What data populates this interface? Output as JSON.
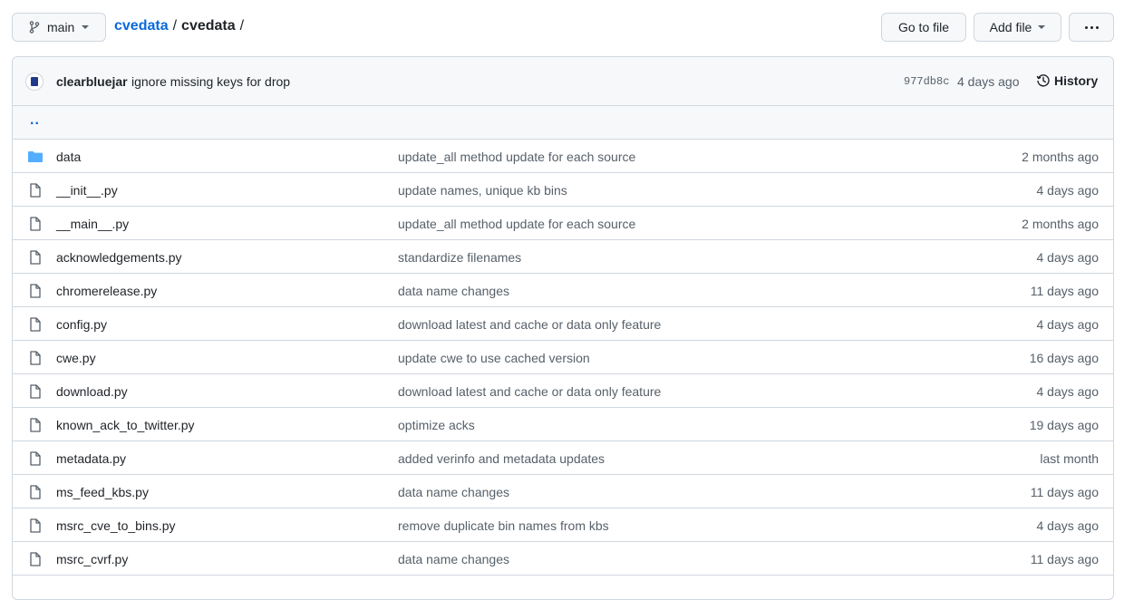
{
  "header": {
    "branch": "main",
    "repo": "cvedata",
    "path_sep": "/",
    "folder": "cvedata",
    "trailing_sep": "/",
    "goto_label": "Go to file",
    "add_label": "Add file"
  },
  "commit": {
    "author": "clearbluejar",
    "message": "ignore missing keys for drop",
    "sha": "977db8c",
    "age": "4 days ago",
    "history_label": "History"
  },
  "parent_link": "..",
  "files": [
    {
      "name": "data",
      "type": "folder",
      "message": "update_all method update for each source",
      "age": "2 months ago"
    },
    {
      "name": "__init__.py",
      "type": "file",
      "message": "update names, unique kb bins",
      "age": "4 days ago"
    },
    {
      "name": "__main__.py",
      "type": "file",
      "message": "update_all method update for each source",
      "age": "2 months ago"
    },
    {
      "name": "acknowledgements.py",
      "type": "file",
      "message": "standardize filenames",
      "age": "4 days ago"
    },
    {
      "name": "chromerelease.py",
      "type": "file",
      "message": "data name changes",
      "age": "11 days ago"
    },
    {
      "name": "config.py",
      "type": "file",
      "message": "download latest and cache or data only feature",
      "age": "4 days ago"
    },
    {
      "name": "cwe.py",
      "type": "file",
      "message": "update cwe to use cached version",
      "age": "16 days ago"
    },
    {
      "name": "download.py",
      "type": "file",
      "message": "download latest and cache or data only feature",
      "age": "4 days ago"
    },
    {
      "name": "known_ack_to_twitter.py",
      "type": "file",
      "message": "optimize acks",
      "age": "19 days ago"
    },
    {
      "name": "metadata.py",
      "type": "file",
      "message": "added verinfo and metadata updates",
      "age": "last month"
    },
    {
      "name": "ms_feed_kbs.py",
      "type": "file",
      "message": "data name changes",
      "age": "11 days ago"
    },
    {
      "name": "msrc_cve_to_bins.py",
      "type": "file",
      "message": "remove duplicate bin names from kbs",
      "age": "4 days ago"
    },
    {
      "name": "msrc_cvrf.py",
      "type": "file",
      "message": "data name changes",
      "age": "11 days ago"
    }
  ],
  "colors": {
    "link": "#0969da",
    "folder": "#54aeff",
    "muted": "#57606a",
    "border": "#d0d7de"
  }
}
